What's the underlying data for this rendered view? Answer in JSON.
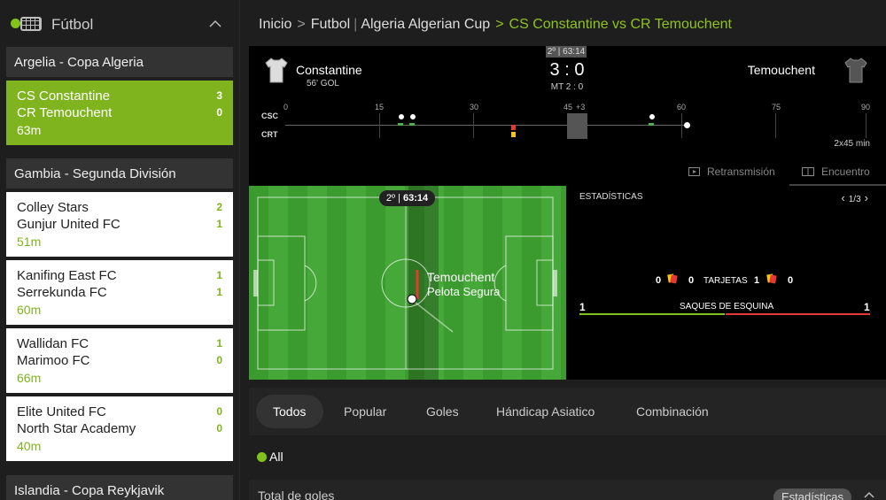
{
  "sidebar": {
    "title": "Fútbol",
    "leagues": [
      {
        "name": "Argelia - Copa Algeria"
      },
      {
        "name": "Gambia - Segunda División"
      },
      {
        "name": "Islandia - Copa Reykjavik"
      }
    ],
    "matches": [
      {
        "home": "CS Constantine",
        "away": "CR Temouchent",
        "home_score": "3",
        "away_score": "0",
        "minute": "63m",
        "active": true
      },
      {
        "home": "Colley Stars",
        "away": "Gunjur United FC",
        "home_score": "2",
        "away_score": "1",
        "minute": "51m"
      },
      {
        "home": "Kanifing East FC",
        "away": "Serrekunda FC",
        "home_score": "1",
        "away_score": "1",
        "minute": "60m"
      },
      {
        "home": "Wallidan FC",
        "away": "Marimoo FC",
        "home_score": "1",
        "away_score": "0",
        "minute": "66m"
      },
      {
        "home": "Elite United FC",
        "away": "North Star Academy",
        "home_score": "0",
        "away_score": "0",
        "minute": "40m"
      }
    ]
  },
  "breadcrumb": {
    "home": "Inicio",
    "sport": "Futbol",
    "league_a": "Algeria",
    "league_b": "Algerian Cup",
    "current": "CS Constantine vs CR Temouchent"
  },
  "scoreboard": {
    "period_badge": "2º | 63:14",
    "home_team": "Constantine",
    "away_team": "Temouchent",
    "goal_note": "56' GOL",
    "score": "3 : 0",
    "halftime": "MT 2 : 0",
    "home_code": "CSC",
    "away_code": "CRT",
    "ticks": [
      "0",
      "15",
      "30",
      "45",
      "+3",
      "60",
      "75",
      "90"
    ],
    "duration": "2x45 min",
    "tab_stream": "Retransmisión",
    "tab_match": "Encuentro"
  },
  "pitch": {
    "period": "2º",
    "clock": "63:14",
    "team": "Temouchent",
    "state": "Pelota Segura"
  },
  "stats": {
    "title": "ESTADÍSTICAS",
    "page": "1/3",
    "cards_label": "TARJETAS",
    "home_yellow": "0",
    "home_red": "0",
    "away_yellow": "1",
    "away_red": "0",
    "corners_label": "SAQUES DE ESQUINA",
    "home_corners": "1",
    "away_corners": "1"
  },
  "markets": {
    "tabs": [
      "Todos",
      "Popular",
      "Goles",
      "Hándicap Asiatico",
      "Combinación"
    ],
    "filter": "All",
    "section": "Total de goles",
    "stats_button": "Estadísticas"
  },
  "colors": {
    "accent": "#7fc31c",
    "yellow_card": "#f5c518",
    "red_card": "#e53935"
  }
}
